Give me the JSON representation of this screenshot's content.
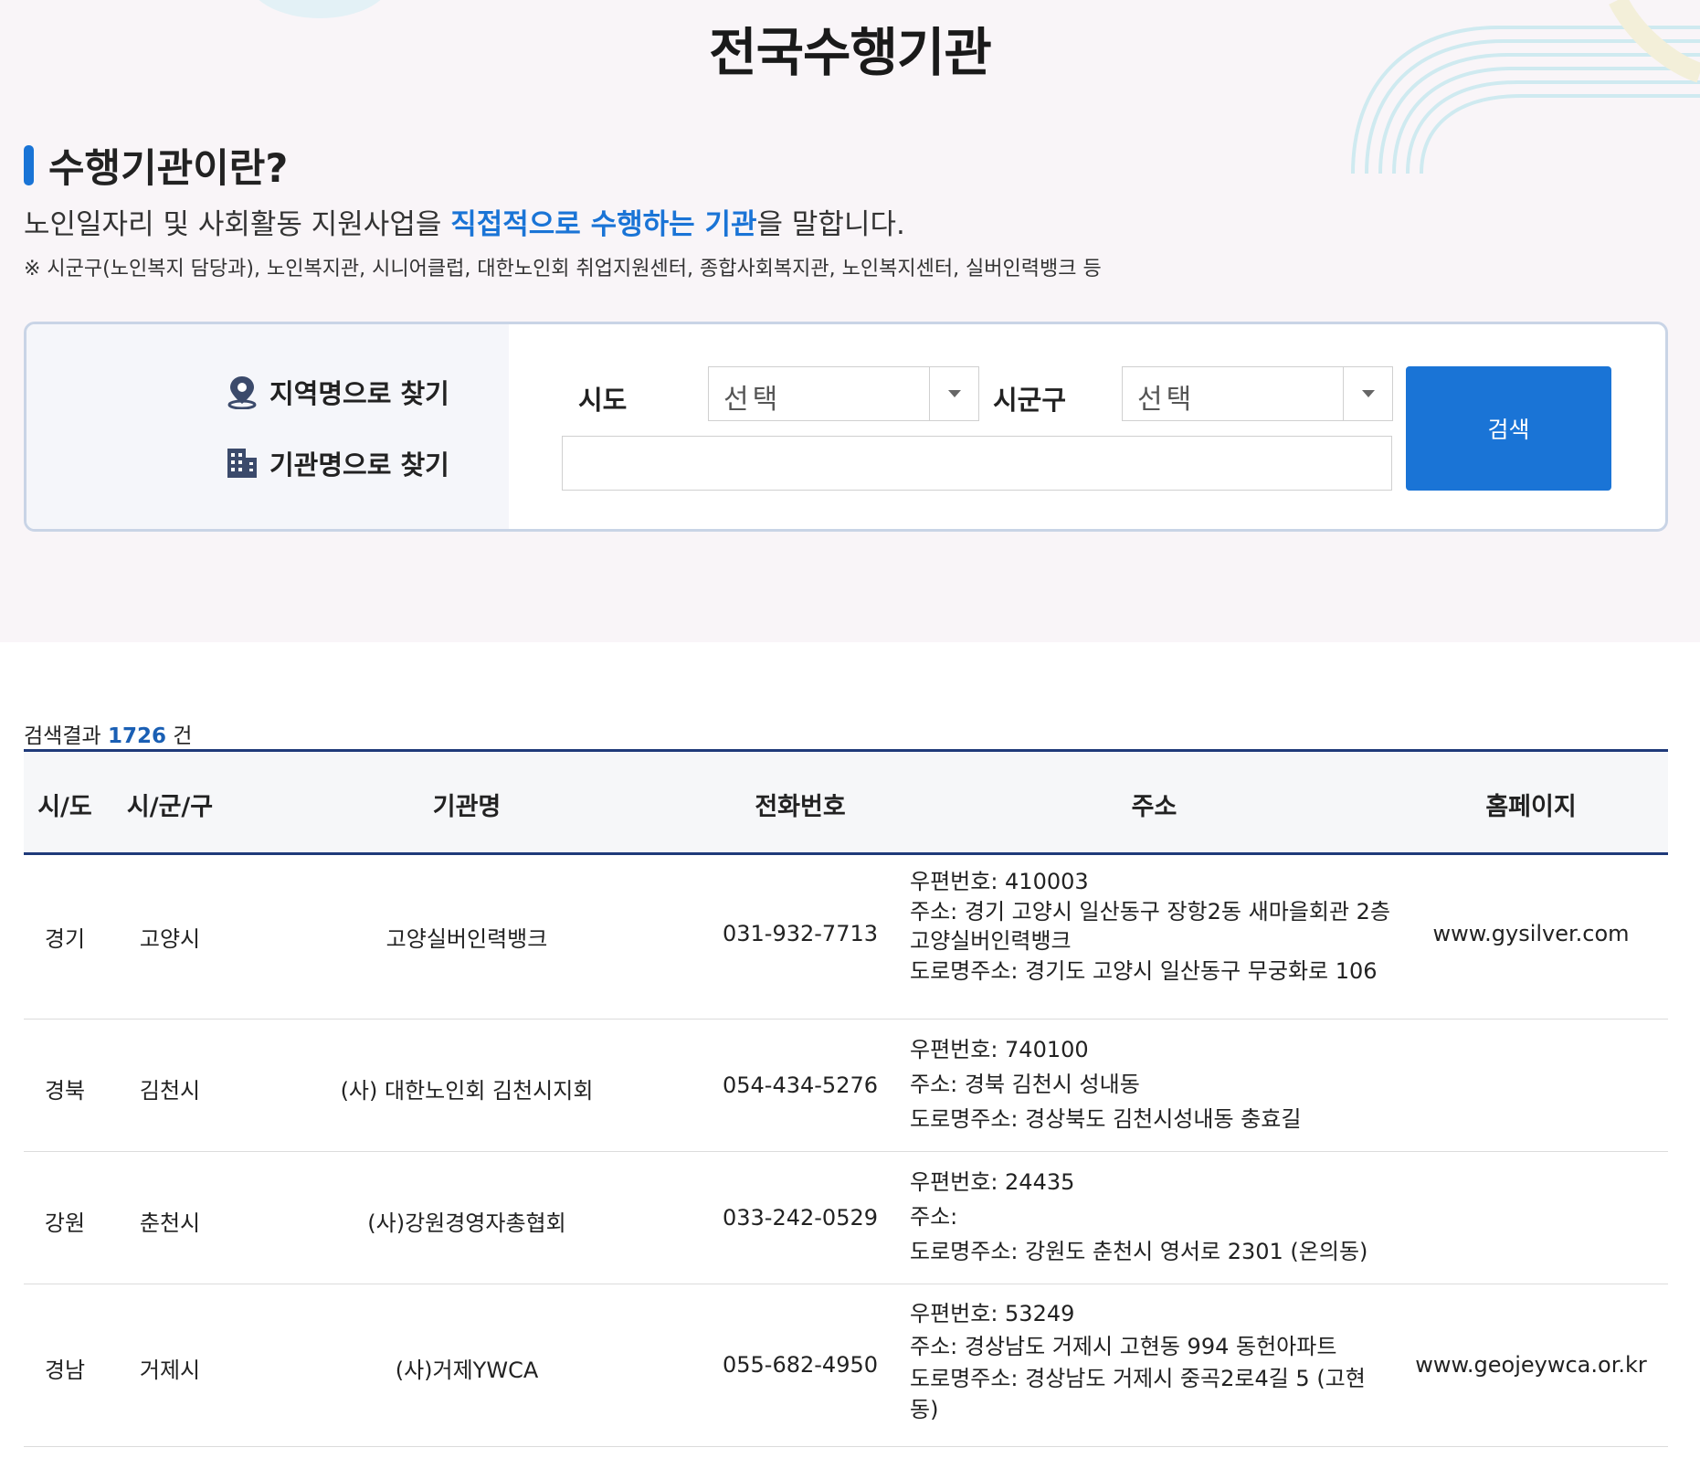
{
  "page": {
    "title": "전국수행기관"
  },
  "intro": {
    "heading": "수행기관이란?",
    "desc_before": "노인일자리 및 사회활동 지원사업을 ",
    "desc_highlight": "직접적으로 수행하는 기관",
    "desc_after": "을 말합니다.",
    "note": "※ 시군구(노인복지 담당과), 노인복지관, 시니어클럽, 대한노인회 취업지원센터, 종합사회복지관, 노인복지센터, 실버인력뱅크 등"
  },
  "search": {
    "find_by_region": "지역명으로 찾기",
    "find_by_org": "기관명으로 찾기",
    "sido_label": "시도",
    "sido_value": "선택",
    "sigungu_label": "시군구",
    "sigungu_value": "선택",
    "org_input_value": "",
    "button_label": "검색"
  },
  "results": {
    "count_prefix": "검색결과 ",
    "count": "1726",
    "count_suffix": " 건",
    "headers": {
      "sido": "시/도",
      "sigungu": "시/군/구",
      "org": "기관명",
      "phone": "전화번호",
      "address": "주소",
      "homepage": "홈페이지"
    },
    "rows": [
      {
        "sido": "경기",
        "sigungu": "고양시",
        "org": "고양실버인력뱅크",
        "phone": "031-932-7713",
        "postcode": "우편번호:  410003",
        "address": "주소:  경기 고양시 일산동구 장항2동 새마을회관 2층 고양실버인력뱅크",
        "road_address": "도로명주소:  경기도 고양시 일산동구 무궁화로 106",
        "homepage": "www.gysilver.com"
      },
      {
        "sido": "경북",
        "sigungu": "김천시",
        "org": "(사) 대한노인회 김천시지회",
        "phone": "054-434-5276",
        "postcode": "우편번호:  740100",
        "address": "주소:  경북 김천시 성내동",
        "road_address": "도로명주소:  경상북도 김천시성내동 충효길",
        "homepage": ""
      },
      {
        "sido": "강원",
        "sigungu": "춘천시",
        "org": "(사)강원경영자총협회",
        "phone": "033-242-0529",
        "postcode": "우편번호:  24435",
        "address": "주소:",
        "road_address": "도로명주소:  강원도 춘천시 영서로 2301 (온의동)",
        "homepage": ""
      },
      {
        "sido": "경남",
        "sigungu": "거제시",
        "org": "(사)거제YWCA",
        "phone": "055-682-4950",
        "postcode": "우편번호:  53249",
        "address": "주소:  경상남도 거제시 고현동 994 동헌아파트",
        "road_address": "도로명주소:  경상남도 거제시 중곡2로4길 5 (고현동)",
        "homepage": "www.geojeywca.or.kr"
      }
    ]
  },
  "colors": {
    "accent": "#1a74d6",
    "header_border": "#1f3a7a",
    "hero_bg": "#f9f5f8"
  }
}
